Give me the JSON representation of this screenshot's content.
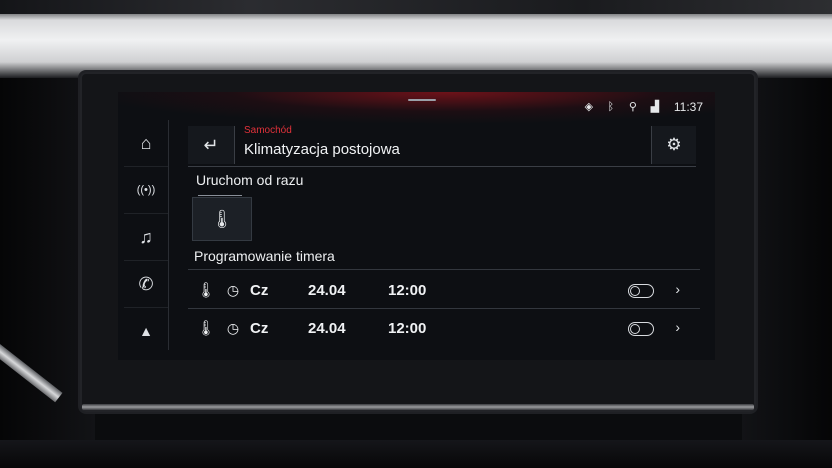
{
  "status_bar": {
    "icons": [
      "location-pin-icon",
      "bluetooth-icon",
      "person-icon",
      "signal-icon"
    ],
    "time": "11:37"
  },
  "nav": {
    "items": [
      {
        "name": "home-icon",
        "glyph": "⌂"
      },
      {
        "name": "radio-icon",
        "glyph": "((•))"
      },
      {
        "name": "music-icon",
        "glyph": "♫"
      },
      {
        "name": "phone-icon",
        "glyph": "✆"
      },
      {
        "name": "navigation-icon",
        "glyph": "▲"
      }
    ]
  },
  "header": {
    "breadcrumb": "Samochód",
    "title": "Klimatyzacja postojowa",
    "back_glyph": "↵",
    "settings_glyph": "⚙"
  },
  "start_now": {
    "label": "Uruchom od razu",
    "tile_glyph": "🌡"
  },
  "timers": {
    "label": "Programowanie timera",
    "rows": [
      {
        "day": "Cz",
        "date": "24.04",
        "time": "12:00",
        "enabled": false
      },
      {
        "day": "Cz",
        "date": "24.04",
        "time": "12:00",
        "enabled": false
      }
    ],
    "therm_glyph": "🌡",
    "clock_glyph": "◷",
    "chevron_glyph": "›"
  },
  "colors": {
    "accent": "#e0323a",
    "background": "#0d0f13",
    "text": "#f0f2f4"
  }
}
